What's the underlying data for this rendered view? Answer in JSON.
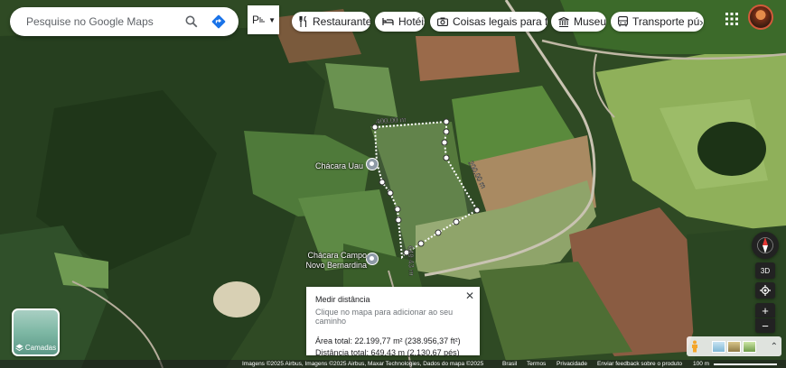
{
  "search": {
    "placeholder": "Pesquise no Google Maps"
  },
  "lang": {
    "label": "P"
  },
  "chips": [
    {
      "label": "Restaurantes",
      "icon": "fork-knife-icon"
    },
    {
      "label": "Hotéis",
      "icon": "bed-icon"
    },
    {
      "label": "Coisas legais para fa...",
      "icon": "camera-icon"
    },
    {
      "label": "Museus",
      "icon": "museum-icon"
    },
    {
      "label": "Transporte pú",
      "icon": "bus-icon"
    }
  ],
  "places": [
    {
      "name": "Chácara Uau"
    },
    {
      "name": "Chácara Campo Novo Bernardina"
    }
  ],
  "measure_labels": {
    "top": "400,00 m",
    "right": "200,00 m",
    "left": "649,43 m"
  },
  "info": {
    "title": "Medir distância",
    "hint": "Clique no mapa para adicionar ao seu caminho",
    "area": "Área total: 22.199,77 m² (238.956,37 ft²)",
    "distance": "Distância total: 649,43 m (2.130,67 pés)"
  },
  "layers": {
    "label": "Camadas"
  },
  "controls": {
    "tilt": "3D"
  },
  "footer": {
    "imagery": "Imagens ©2025 Airbus, Imagens ©2025 Airbus, Maxar Technologies, Dados do mapa ©2025",
    "country": "Brasil",
    "terms": "Termos",
    "privacy": "Privacidade",
    "feedback": "Enviar feedback sobre o produto",
    "scale": "100 m"
  },
  "colors": {
    "accent": "#1a73e8",
    "measure_line": "#ffffff"
  }
}
